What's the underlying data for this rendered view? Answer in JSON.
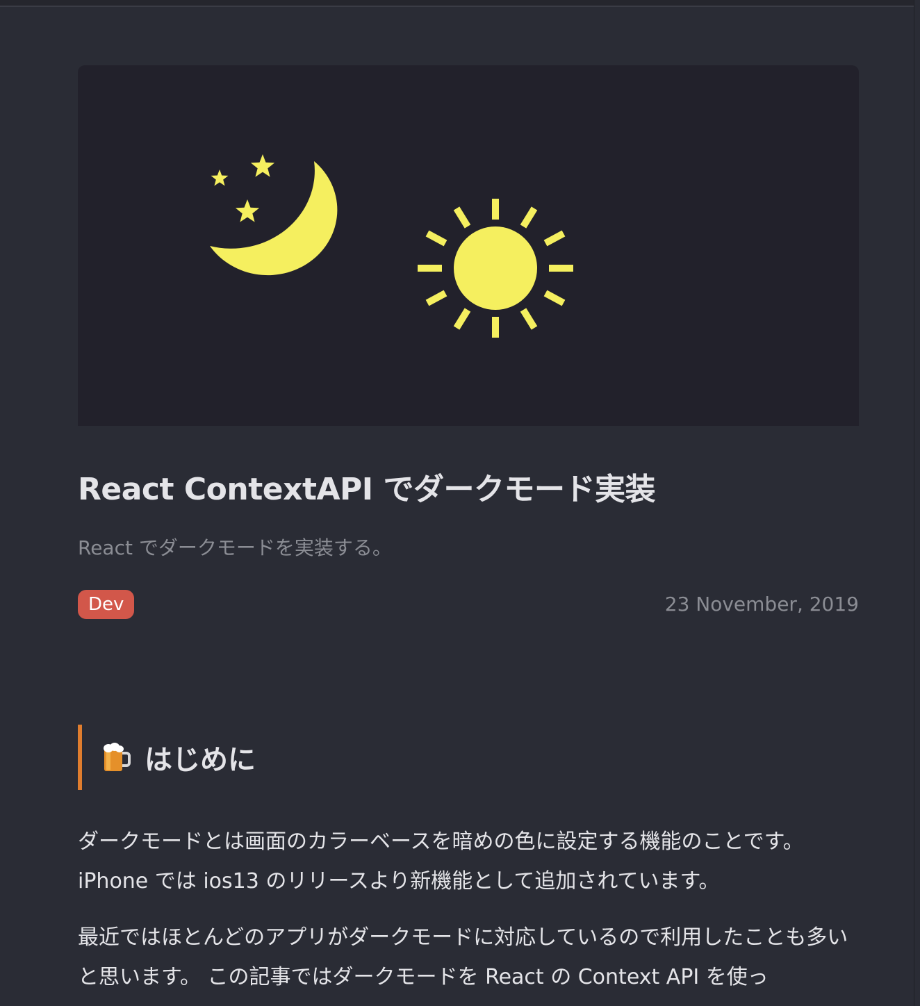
{
  "article": {
    "title": "React ContextAPI でダークモード実装",
    "description": "React でダークモードを実装する。",
    "tag": "Dev",
    "date": "23 November, 2019",
    "hero_icons": [
      "moon-stars-icon",
      "sun-icon"
    ],
    "colors": {
      "background": "#2a2c35",
      "hero_background": "#22212b",
      "icon_yellow": "#f5ef5f",
      "tag": "#d2574a",
      "heading_bar": "#e07d2e"
    }
  },
  "section": {
    "heading": "はじめに",
    "heading_icon": "beer-mug-icon",
    "paragraphs": [
      "ダークモードとは画面のカラーベースを暗めの色に設定する機能のことです。 iPhone では ios13 のリリースより新機能として追加されています。",
      "最近ではほとんどのアプリがダークモードに対応しているので利用したことも多いと思います。 この記事ではダークモードを React の Context API を使っ"
    ]
  }
}
